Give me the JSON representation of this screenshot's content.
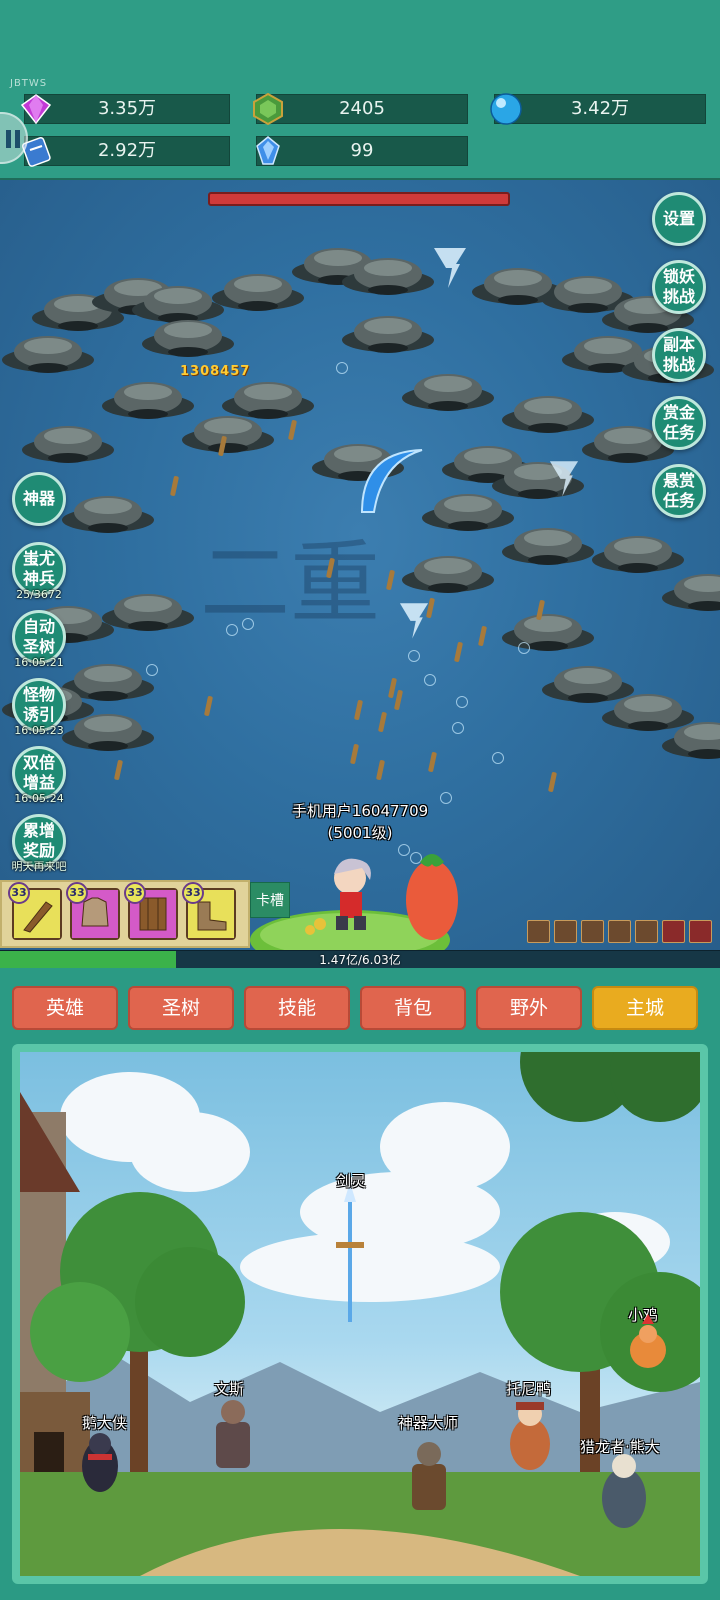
{
  "header": {
    "tag": "JBTWS",
    "resources": [
      {
        "icon": "purple-gem-icon",
        "value": "3.35万"
      },
      {
        "icon": "green-crystal-icon",
        "value": "2405"
      },
      {
        "icon": "blue-orb-icon",
        "value": "3.42万"
      },
      {
        "icon": "scroll-ticket-icon",
        "value": "2.92万"
      },
      {
        "icon": "blue-shard-icon",
        "value": "99"
      }
    ]
  },
  "battle": {
    "damage_text": "1308457",
    "player_name": "手机用户16047709",
    "player_level": "(5001级)",
    "exp_text": "1.47亿/6.03亿",
    "exp_fill_fraction": 0.244,
    "watermark": "二重",
    "right_buttons": [
      {
        "label": "设置"
      },
      {
        "label": "锁妖\n挑战"
      },
      {
        "label": "副本\n挑战"
      },
      {
        "label": "赏金\n任务"
      },
      {
        "label": "悬赏\n任务"
      }
    ],
    "left_buttons": [
      {
        "label": "神器",
        "sub": ""
      },
      {
        "label": "蚩尤\n神兵",
        "sub": "25/3672"
      },
      {
        "label": "自动\n圣树",
        "sub": "16:05:21"
      },
      {
        "label": "怪物\n诱引",
        "sub": "16:05:23"
      },
      {
        "label": "双倍\n增益",
        "sub": "16:05:24"
      },
      {
        "label": "累增\n奖励",
        "sub": "明天再来吧"
      }
    ],
    "cards": [
      {
        "level": "33",
        "item": "club",
        "color": "#e8e05a"
      },
      {
        "level": "33",
        "item": "armor",
        "color": "#d45ac8"
      },
      {
        "level": "33",
        "item": "shield",
        "color": "#d45ac8"
      },
      {
        "level": "33",
        "item": "boots",
        "color": "#e8e05a"
      }
    ],
    "slot_label": "卡槽"
  },
  "tabs": [
    {
      "label": "英雄",
      "active": false
    },
    {
      "label": "圣树",
      "active": false
    },
    {
      "label": "技能",
      "active": false
    },
    {
      "label": "背包",
      "active": false
    },
    {
      "label": "野外",
      "active": false
    },
    {
      "label": "主城",
      "active": true
    }
  ],
  "city": {
    "npcs": [
      {
        "name": "剑灵"
      },
      {
        "name": "小鸡"
      },
      {
        "name": "文斯"
      },
      {
        "name": "托尼鸭"
      },
      {
        "name": "鹅大侠"
      },
      {
        "name": "神器大师"
      },
      {
        "name": "猎龙者·熊大"
      }
    ]
  },
  "colors": {
    "accent": "#2f9d86",
    "tab": "#e0654e",
    "tab_active": "#e9ab1f",
    "boss_hp": "#d03a3a"
  }
}
